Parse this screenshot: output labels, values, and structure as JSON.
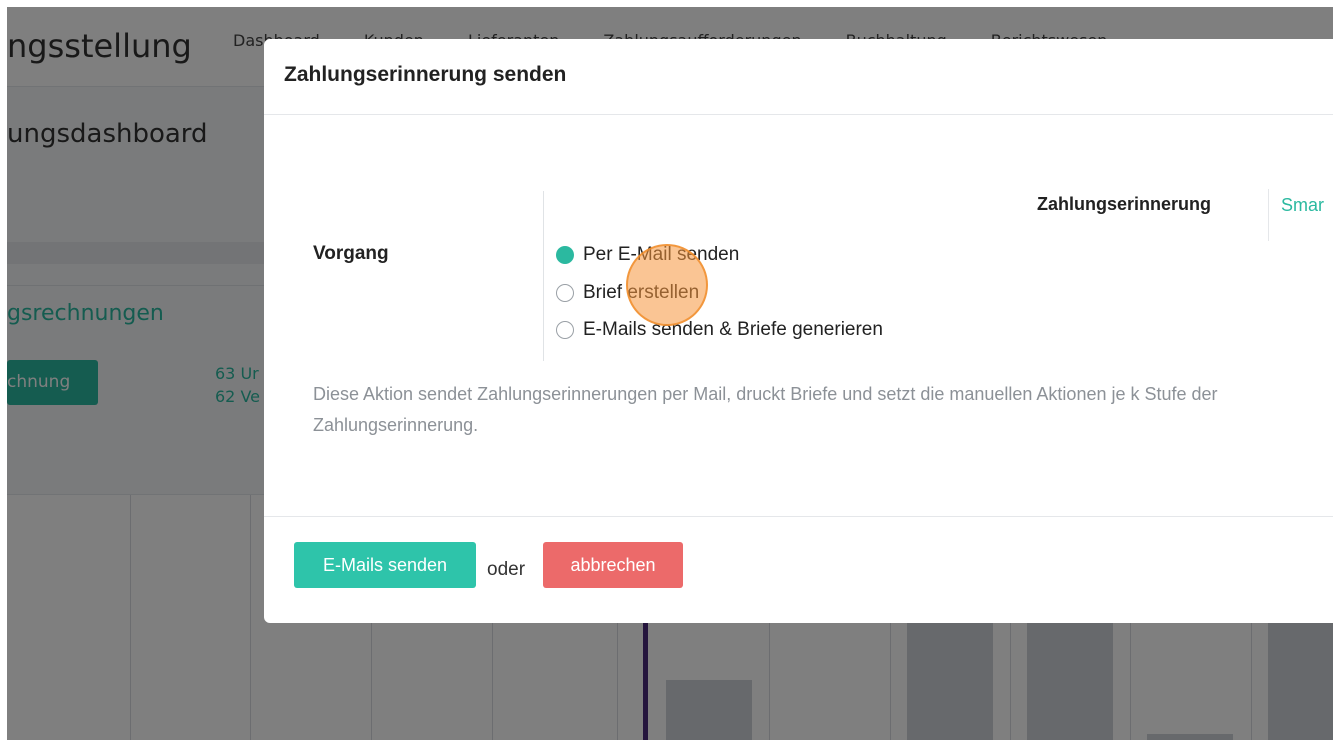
{
  "app": {
    "title": "ngsstellung",
    "nav": [
      "Dashboard",
      "Kunden",
      "Lieferanten",
      "Zahlungsaufforderungen",
      "Buchhaltung",
      "Berichtswesen"
    ],
    "page_title": "ungsdashboard",
    "section_title": "gsrechnungen",
    "button_label": "chnung",
    "stats": [
      "63 Ur",
      "62 Ve"
    ]
  },
  "modal": {
    "title": "Zahlungserinnerung senden",
    "tabs": {
      "active": "Zahlungserinnerung",
      "next": "Smar"
    },
    "field_label": "Vorgang",
    "options": [
      {
        "label": "Per E-Mail senden",
        "checked": true
      },
      {
        "label": "Brief erstellen",
        "checked": false
      },
      {
        "label": "E-Mails senden & Briefe generieren",
        "checked": false
      }
    ],
    "description": "Diese Aktion sendet Zahlungserinnerungen per Mail, druckt Briefe und setzt die manuellen Aktionen je k Stufe der Zahlungserinnerung.",
    "footer": {
      "primary": "E-Mails senden",
      "or": "oder",
      "cancel": "abbrechen"
    }
  },
  "colors": {
    "accent": "#2ec4aa",
    "danger": "#ec6a6a",
    "cursor_highlight": "#f5963c"
  }
}
